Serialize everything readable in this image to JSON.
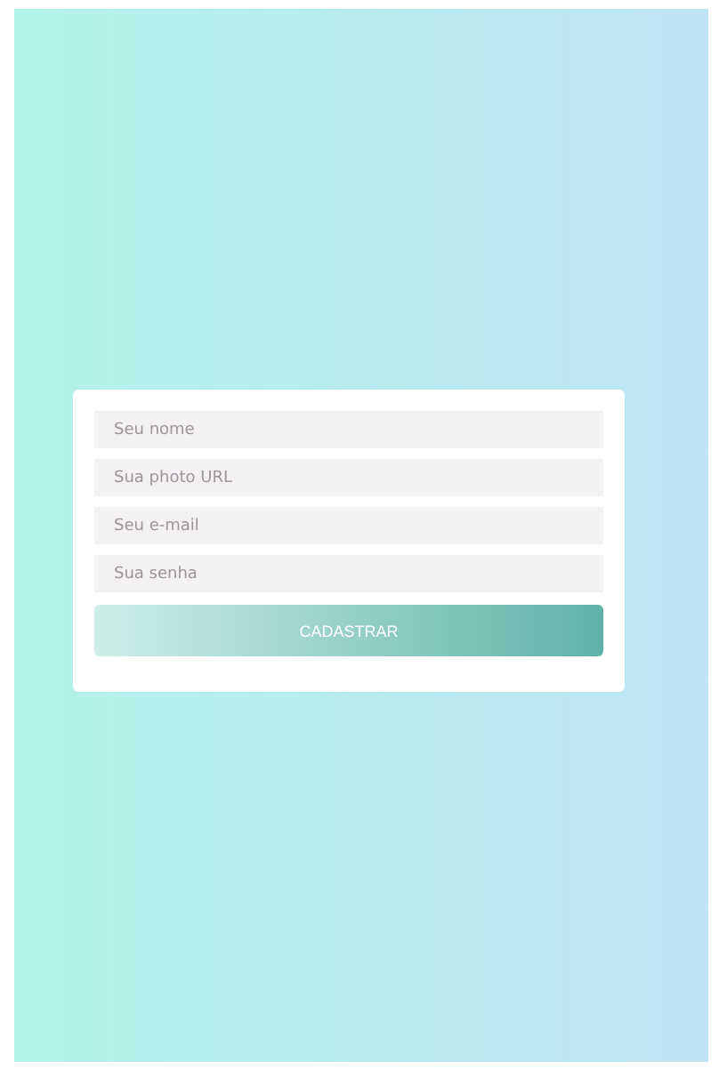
{
  "form": {
    "fields": [
      {
        "placeholder": "Seu nome"
      },
      {
        "placeholder": "Sua photo URL"
      },
      {
        "placeholder": "Seu e-mail"
      },
      {
        "placeholder": "Sua senha"
      }
    ],
    "button": "CADASTRAR"
  }
}
